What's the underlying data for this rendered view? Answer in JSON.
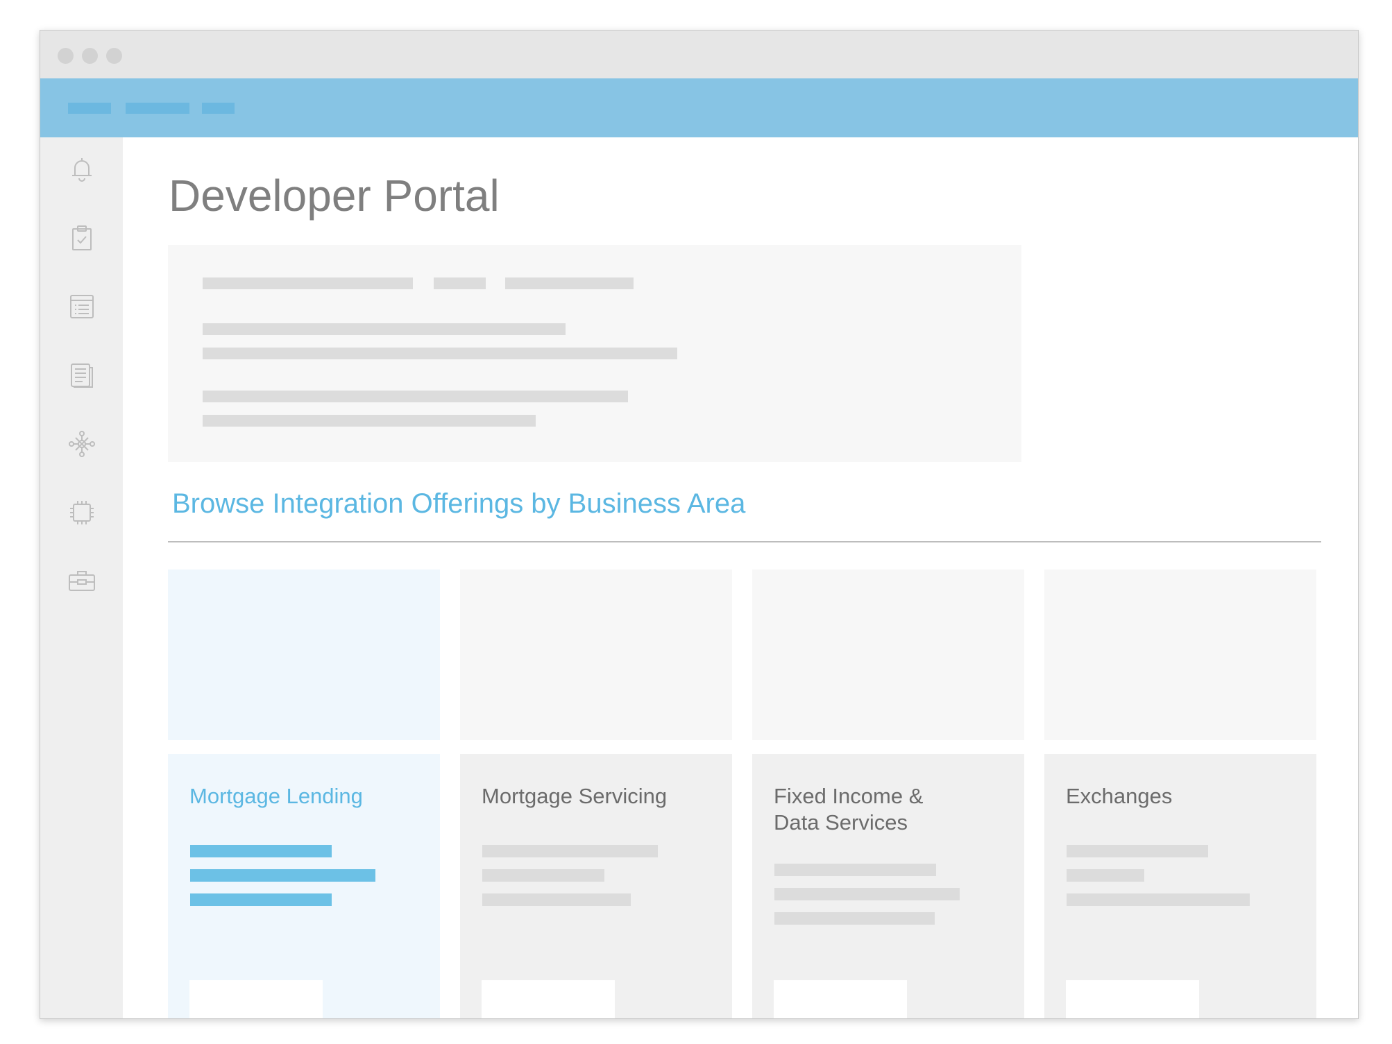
{
  "window": {
    "title_bar_dots": [
      "close",
      "minimize",
      "maximize"
    ]
  },
  "sidebar": {
    "icons": [
      "bell-icon",
      "clipboard-check-icon",
      "list-icon",
      "documents-icon",
      "network-icon",
      "chip-icon",
      "briefcase-icon"
    ]
  },
  "main": {
    "title": "Developer Portal",
    "section_title": "Browse Integration Offerings by Business Area"
  },
  "cards": [
    {
      "title": "Mortgage Lending",
      "selected": true
    },
    {
      "title": "Mortgage Servicing",
      "selected": false
    },
    {
      "title": "Fixed Income &\nData Services",
      "selected": false
    },
    {
      "title": "Exchanges",
      "selected": false
    }
  ],
  "colors": {
    "accent": "#5bb7e2",
    "top_nav": "#87c4e4",
    "sidebar": "#efefef",
    "selected_card": "#eff7fd",
    "card": "#f0f0f0"
  }
}
